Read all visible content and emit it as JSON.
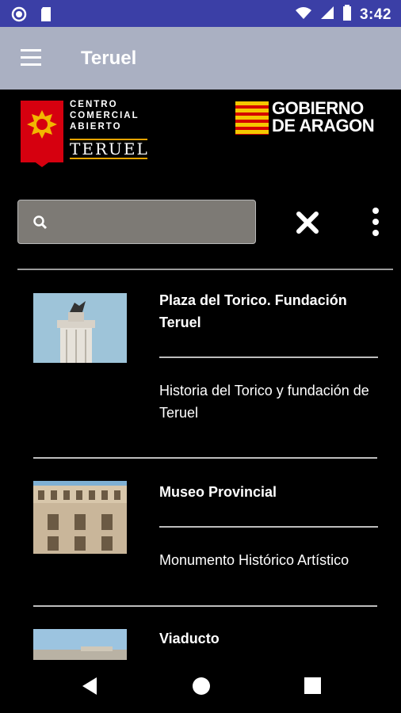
{
  "status_bar": {
    "time": "3:42"
  },
  "app_bar": {
    "title": "Teruel",
    "menu_icon": "hamburger-menu-icon"
  },
  "logos": {
    "cca": {
      "line1": "CENTRO",
      "line2": "COMERCIAL",
      "line3": "ABIERTO",
      "line4": "TERUEL"
    },
    "aragon": {
      "line1": "GOBIERNO",
      "line2": "DE ARAGON"
    }
  },
  "search": {
    "value": "",
    "placeholder": ""
  },
  "items": [
    {
      "title": "Plaza del Torico. Fundación Teruel",
      "description": "Historia del Torico y fundación de Teruel"
    },
    {
      "title": "Museo Provincial",
      "description": "Monumento Histórico Artístico"
    },
    {
      "title": "Viaducto",
      "description": ""
    }
  ],
  "colors": {
    "status_bar": "#3b3fa6",
    "app_bar": "#aab0c2",
    "search_bg": "#7d7a75",
    "background": "#000000"
  }
}
